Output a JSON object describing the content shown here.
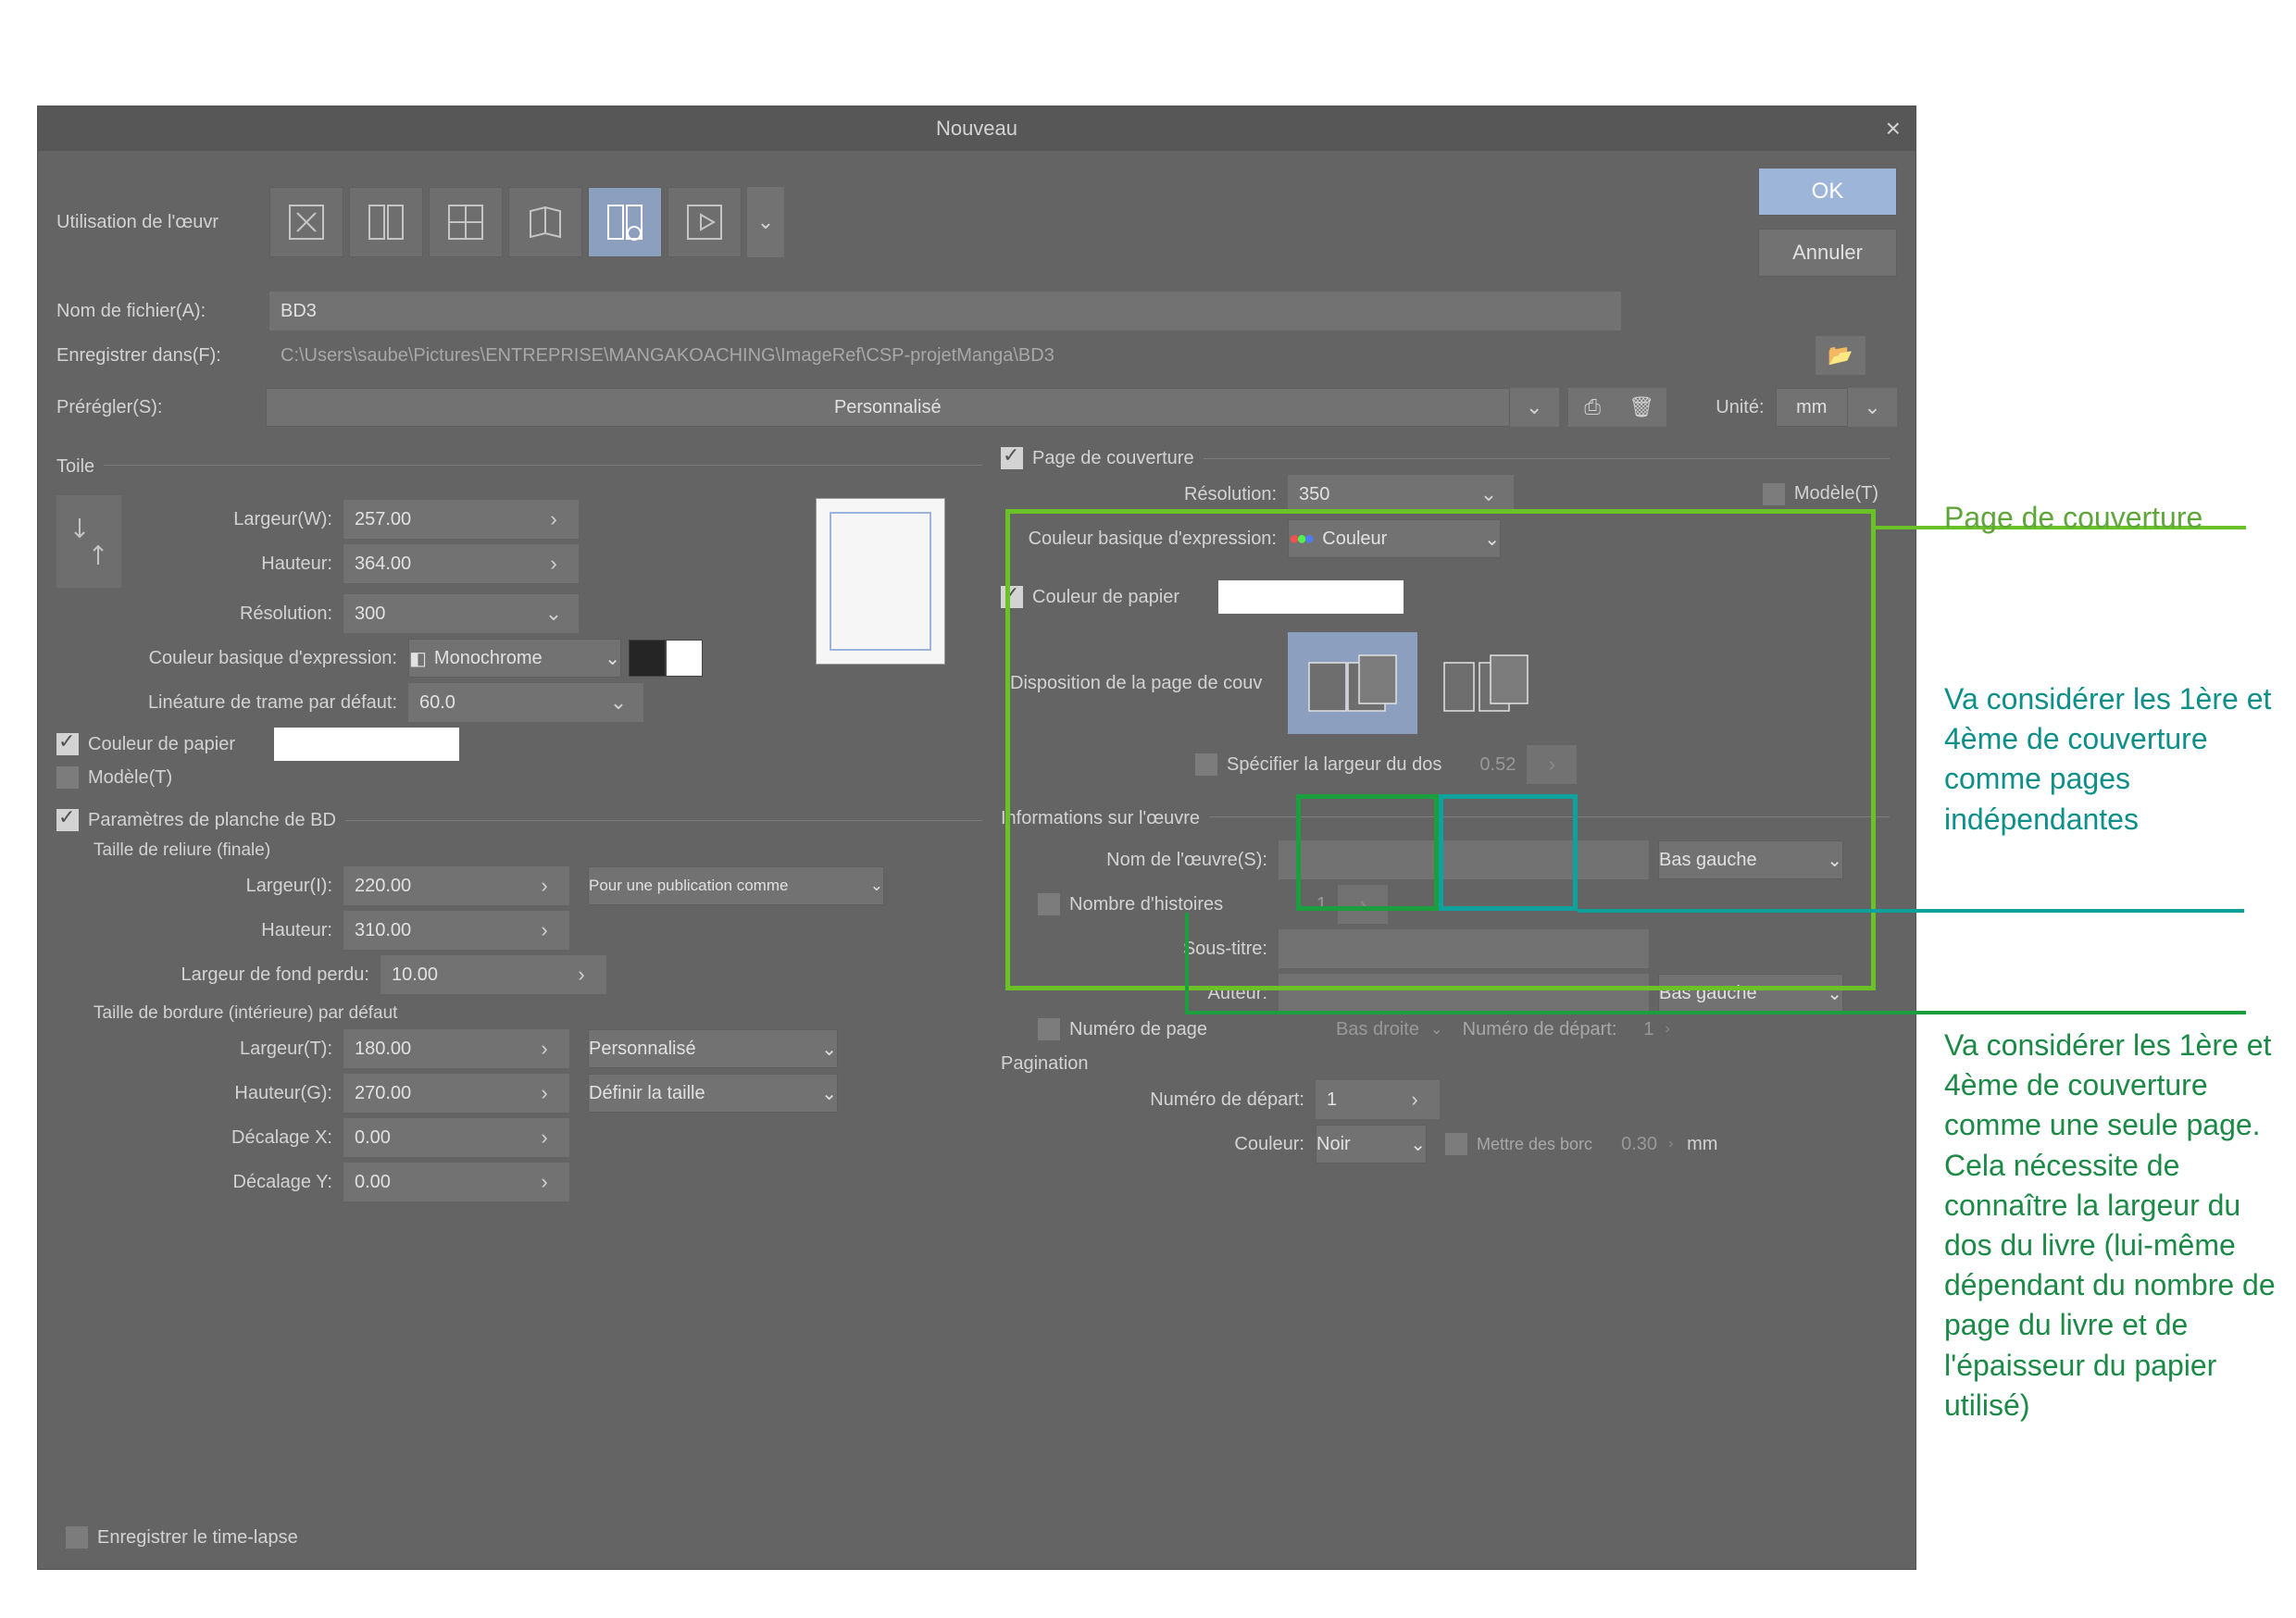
{
  "dialog": {
    "title": "Nouveau"
  },
  "topbar": {
    "usage_label": "Utilisation de l'œuvr",
    "ok": "OK",
    "cancel": "Annuler"
  },
  "filename": {
    "label": "Nom de fichier(A):",
    "value": "BD3"
  },
  "savein": {
    "label": "Enregistrer dans(F):",
    "value": "C:\\Users\\saube\\Pictures\\ENTREPRISE\\MANGAKOACHING\\ImageRef\\CSP-projetManga\\BD3"
  },
  "preset": {
    "label": "Prérégler(S):",
    "value": "Personnalisé",
    "unit_label": "Unité:",
    "unit": "mm"
  },
  "canvas": {
    "header": "Toile",
    "width_label": "Largeur(W):",
    "width": "257.00",
    "height_label": "Hauteur:",
    "height": "364.00",
    "res_label": "Résolution:",
    "res": "300",
    "expr_label": "Couleur basique d'expression:",
    "expr": "Monochrome",
    "lineature_label": "Linéature de trame par défaut:",
    "lineature": "60.0",
    "paper_color_label": "Couleur de papier",
    "template_label": "Modèle(T)"
  },
  "manga": {
    "header": "Paramètres de planche de BD",
    "binding_size_header": "Taille de reliure (finale)",
    "widthI_label": "Largeur(I):",
    "widthI": "220.00",
    "pub_dropdown": "Pour une publication comme",
    "height_label": "Hauteur:",
    "height": "310.00",
    "bleed_label": "Largeur de fond perdu:",
    "bleed": "10.00",
    "inner_border_header": "Taille de bordure (intérieure) par défaut",
    "widthT_label": "Largeur(T):",
    "widthT": "180.00",
    "widthT_preset": "Personnalisé",
    "heightG_label": "Hauteur(G):",
    "heightG": "270.00",
    "def_size": "Définir la taille",
    "offsetX_label": "Décalage X:",
    "offsetX": "0.00",
    "offsetY_label": "Décalage Y:",
    "offsetY": "0.00"
  },
  "cover": {
    "header": "Page de couverture",
    "res_label": "Résolution:",
    "res": "350",
    "template_label": "Modèle(T)",
    "expr_label": "Couleur basique d'expression:",
    "expr": "Couleur",
    "paper_color_label": "Couleur de papier",
    "layout_label": "Disposition de la page de couv",
    "spine_label": "Spécifier la largeur du dos",
    "spine": "0.52"
  },
  "work": {
    "header": "Informations sur l'œuvre",
    "name_label": "Nom de l'œuvre(S):",
    "name_pos": "Bas gauche",
    "stories_label": "Nombre d'histoires",
    "stories": "1",
    "subtitle_label": "Sous-titre:",
    "author_label": "Auteur:",
    "author_pos": "Bas gauche",
    "pagenum_label": "Numéro de page",
    "pagenum_pos": "Bas droite",
    "startnum_label": "Numéro de départ:",
    "startnum": "1",
    "pagination_header": "Pagination",
    "start_label": "Numéro de départ:",
    "start": "1",
    "color_label": "Couleur:",
    "color": "Noir",
    "border_label": "Mettre des borc",
    "border": "0.30",
    "mm": "mm"
  },
  "timelapse": {
    "label": "Enregistrer le time-lapse"
  },
  "annotations": {
    "cover_title": "Page de couverture",
    "independent": "Va considérer les 1ère et 4ème de couverture comme pages indépendantes",
    "single": "Va considérer les 1ère et 4ème de couverture comme une seule page. Cela nécessite de connaître la largeur du dos du livre (lui-même dépendant du nombre de page du livre et de l'épaisseur du papier utilisé)"
  }
}
